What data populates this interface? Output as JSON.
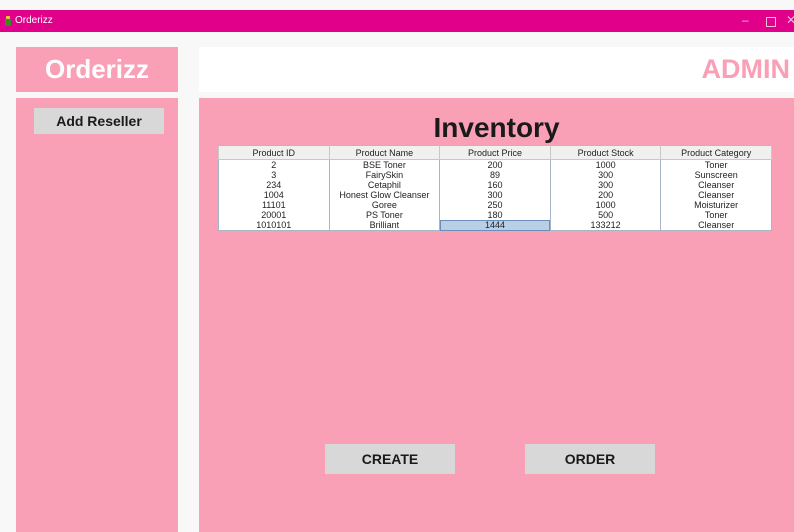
{
  "window": {
    "title": "Orderizz"
  },
  "brand": {
    "logo_text": "Orderizz"
  },
  "header": {
    "role_label": "ADMIN"
  },
  "sidebar": {
    "add_reseller_label": "Add Reseller"
  },
  "main": {
    "heading": "Inventory",
    "table": {
      "columns": [
        "Product ID",
        "Product Name",
        "Product Price",
        "Product Stock",
        "Product Category"
      ],
      "rows": [
        [
          "2",
          "BSE Toner",
          "200",
          "1000",
          "Toner"
        ],
        [
          "3",
          "FairySkin",
          "89",
          "300",
          "Sunscreen"
        ],
        [
          "234",
          "Cetaphil",
          "160",
          "300",
          "Cleanser"
        ],
        [
          "1004",
          "Honest Glow Cleanser",
          "300",
          "200",
          "Cleanser"
        ],
        [
          "11101",
          "Goree",
          "250",
          "1000",
          "Moisturizer"
        ],
        [
          "20001",
          "PS Toner",
          "180",
          "500",
          "Toner"
        ],
        [
          "1010101",
          "Brilliant",
          "1444",
          "133212",
          "Cleanser"
        ]
      ],
      "selected_cell": "row 7, Product Price"
    },
    "create_label": "CREATE",
    "order_label": "ORDER"
  },
  "colors": {
    "titlebar": "#e0008a",
    "panel_pink": "#f9a0b7",
    "button_gray": "#d8d8d8",
    "selection": "#b8cfe5"
  },
  "icons": [
    "app-icon",
    "minimize-icon",
    "maximize-icon",
    "close-icon"
  ]
}
